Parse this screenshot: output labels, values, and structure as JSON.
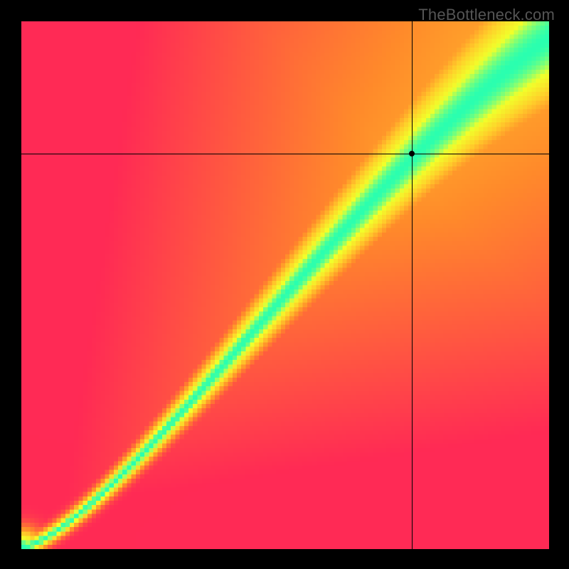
{
  "watermark": "TheBottleneck.com",
  "chart_data": {
    "type": "heatmap",
    "title": "",
    "xlabel": "",
    "ylabel": "",
    "xlim": [
      0,
      100
    ],
    "ylim": [
      0,
      100
    ],
    "marker": {
      "x": 74,
      "y": 75
    },
    "crosshair": {
      "x": 74,
      "y": 75
    },
    "colormap": [
      "#ff2a55",
      "#ff8c2a",
      "#ffd02a",
      "#f2ff2a",
      "#2affb0"
    ],
    "description": "Pixelated heatmap with a narrow green optimal band running diagonally from lower-left toward upper-right, widening near the top. Surrounding regions transition through yellow and orange to red at the extremes. A black crosshair and dot mark a point in the upper-right quadrant near the green band.",
    "grid": false
  }
}
